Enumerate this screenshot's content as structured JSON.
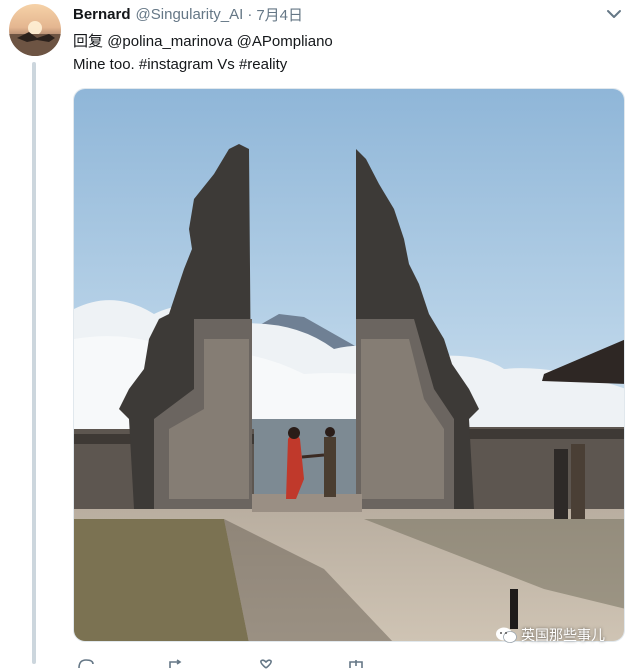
{
  "tweet": {
    "display_name": "Bernard",
    "handle": "@Singularity_AI",
    "separator": "·",
    "timestamp": "7月4日",
    "reply_prefix": "回复",
    "reply_mentions": [
      "@polina_marinova",
      "@APompliano"
    ],
    "text_plain": "Mine too.",
    "hashtags": [
      "#instagram",
      "#reality"
    ],
    "text_joiner": "Vs"
  },
  "media": {
    "alt": "Two figures holding hands between the split gates of a Balinese temple with a mountain and clouds behind"
  },
  "watermark": {
    "label": "英国那些事儿"
  },
  "icons": {
    "more": "chevron-down-icon",
    "reply": "reply-icon",
    "retweet": "retweet-icon",
    "like": "heart-icon",
    "share": "share-icon"
  },
  "colors": {
    "text": "#14171a",
    "muted": "#657786",
    "thread_line": "#ccd6dd"
  }
}
